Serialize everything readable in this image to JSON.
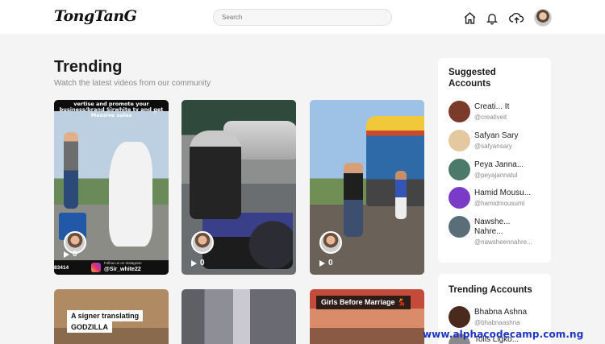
{
  "header": {
    "logo": "TongTanG",
    "search_placeholder": "Search",
    "icons": [
      "home-icon",
      "bell-icon",
      "upload-cloud-icon",
      "avatar"
    ]
  },
  "main": {
    "title": "Trending",
    "subtitle": "Watch the latest videos from our community",
    "videos": [
      {
        "banner": "vertise and promote your business/brand Sirwhite tv and get Massive sales",
        "footer_number": "83414",
        "footer_follow": "Follow us on Instagram",
        "footer_handle": "@Sir_white22",
        "plays": "0"
      },
      {
        "plays": "0"
      },
      {
        "plays": "0"
      },
      {
        "caption_line1": "A signer translating",
        "caption_line2": "GODZILLA"
      },
      {},
      {
        "caption": "Girls Before Marriage 💃"
      }
    ]
  },
  "suggested": {
    "title": "Suggested Accounts",
    "accounts": [
      {
        "name": "Creati... It",
        "handle": "@creativeit",
        "avatar_color": "#7a3b2a"
      },
      {
        "name": "Safyan Sary",
        "handle": "@safyansary",
        "avatar_color": "#e3c8a0"
      },
      {
        "name": "Peya Janna...",
        "handle": "@peyajannatul",
        "avatar_color": "#4c7a6a"
      },
      {
        "name": "Hamid Mousu...",
        "handle": "@hamidmousumi",
        "avatar_color": "#7a3cc8"
      },
      {
        "name_line1": "Nawshe...",
        "name_line2": "Nahre...",
        "handle": "@nawsheennahre...",
        "avatar_color": "#5a6e7a"
      }
    ]
  },
  "trending_accounts": {
    "title": "Trending Accounts",
    "accounts": [
      {
        "name": "Bhabna Ashna",
        "handle": "@bhabnaashna",
        "avatar_color": "#4a2a1c"
      },
      {
        "name": "Tolis Ligko...",
        "avatar_color": "#8a8a8a"
      }
    ]
  },
  "watermark": "www.alphacodecamp.com.ng"
}
